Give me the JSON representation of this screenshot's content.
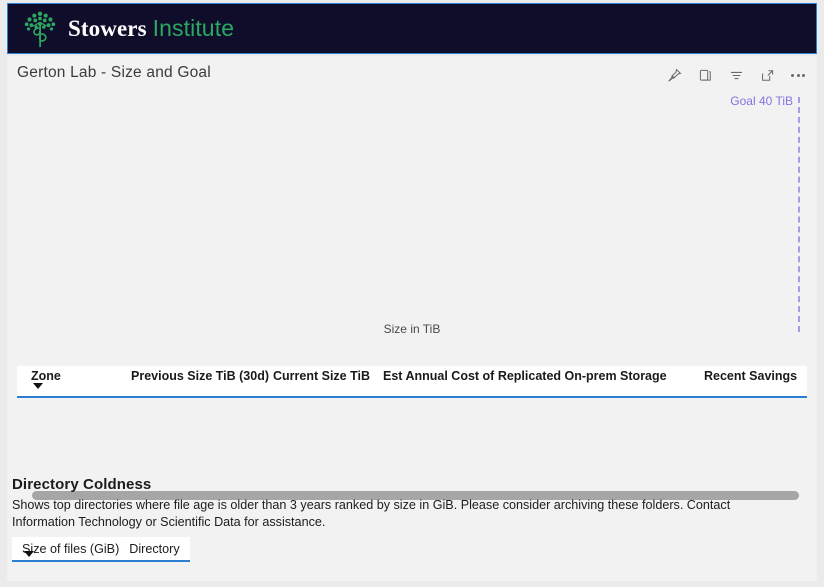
{
  "brand": {
    "logo_icon": "tree-icon",
    "name_primary": "Stowers",
    "name_secondary": "Institute",
    "bar_color": "#100d2b",
    "accent_green": "#2aa860",
    "border_blue": "#2d7fd3"
  },
  "card": {
    "title": "Gerton Lab - Size and Goal",
    "toolbar": [
      {
        "name": "pin-icon",
        "label": "Pin"
      },
      {
        "name": "copy-icon",
        "label": "Copy"
      },
      {
        "name": "filter-icon",
        "label": "Filter"
      },
      {
        "name": "expand-icon",
        "label": "Focus mode"
      },
      {
        "name": "more-options-icon",
        "label": "More options"
      }
    ]
  },
  "chart_data": {
    "type": "bar",
    "title": "Gerton Lab - Size and Goal",
    "xlabel": "Size in TiB",
    "ylabel": "",
    "categories": [],
    "values": [],
    "series": [],
    "annotations": [
      {
        "name": "goal-line",
        "label": "Goal 40 TiB",
        "value": 40,
        "units": "TiB",
        "orientation": "vertical",
        "style": "dashed",
        "color": "#8672e0"
      }
    ],
    "axis_label_text": "Size in TiB",
    "grid": false,
    "legend": "none",
    "note": "no bars rendered / data empty"
  },
  "main_table": {
    "columns": [
      {
        "label": "Zone",
        "sorted": true,
        "sort_dir": "desc"
      },
      {
        "label": "Previous Size TiB (30d)",
        "sorted": false
      },
      {
        "label": "Current Size TiB",
        "sorted": false
      },
      {
        "label": "Est Annual Cost of Replicated On-prem Storage",
        "sorted": false
      },
      {
        "label": "Recent Savings",
        "sorted": false
      }
    ],
    "rows": [],
    "underline_color": "#2a7fd1",
    "scrollbar": {
      "name": "horizontal-scrollbar",
      "position": 0
    }
  },
  "coldness": {
    "heading": "Directory Coldness",
    "description": "Shows top directories where file age is older than 3 years ranked by size in GiB. Please consider archiving these folders. Contact Information Technology or Scientific Data for assistance.",
    "table": {
      "columns": [
        {
          "label": "Size of files (GiB)",
          "sorted": true,
          "sort_dir": "desc"
        },
        {
          "label": "Directory",
          "sorted": false
        }
      ],
      "rows": []
    }
  }
}
